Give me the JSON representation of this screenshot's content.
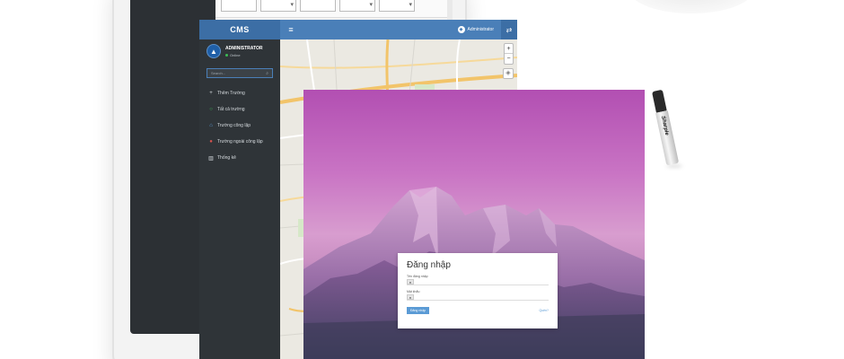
{
  "back_device": {
    "filter_selects": [
      "",
      "",
      "",
      "",
      ""
    ]
  },
  "cms": {
    "logo": "CMS",
    "menu_icon": "hamburger-icon",
    "header_user": "Administrator",
    "swap_icon": "swap-icon",
    "profile": {
      "name": "ADMINISTRATOR",
      "status": "Online",
      "status_color": "#3cba54"
    },
    "search": {
      "placeholder": "Search..."
    },
    "nav": [
      {
        "label": "Thêm Trường",
        "icon": "plus-icon",
        "glyph": "+"
      },
      {
        "label": "Tất cả trường",
        "icon": "circle-icon",
        "glyph": "○"
      },
      {
        "label": "Trường công lập",
        "icon": "home-icon",
        "glyph": "⌂"
      },
      {
        "label": "Trường ngoài công lập",
        "icon": "pin-icon",
        "glyph": "●"
      },
      {
        "label": "Thống kê",
        "icon": "bar-chart-icon",
        "glyph": "▥"
      }
    ],
    "map": {
      "zoom_in": "+",
      "zoom_out": "−"
    },
    "colors": {
      "header": "#4a7fb8",
      "sidebar": "#2f3438",
      "accent": "#4a7fb8"
    }
  },
  "login": {
    "title": "Đăng nhập",
    "username_label": "Tên đăng nhập",
    "password_label": "Mật khẩu",
    "submit_label": "Đăng nhập",
    "forgot_label": "Quên?"
  },
  "marker": {
    "brand": "Sharpie"
  }
}
